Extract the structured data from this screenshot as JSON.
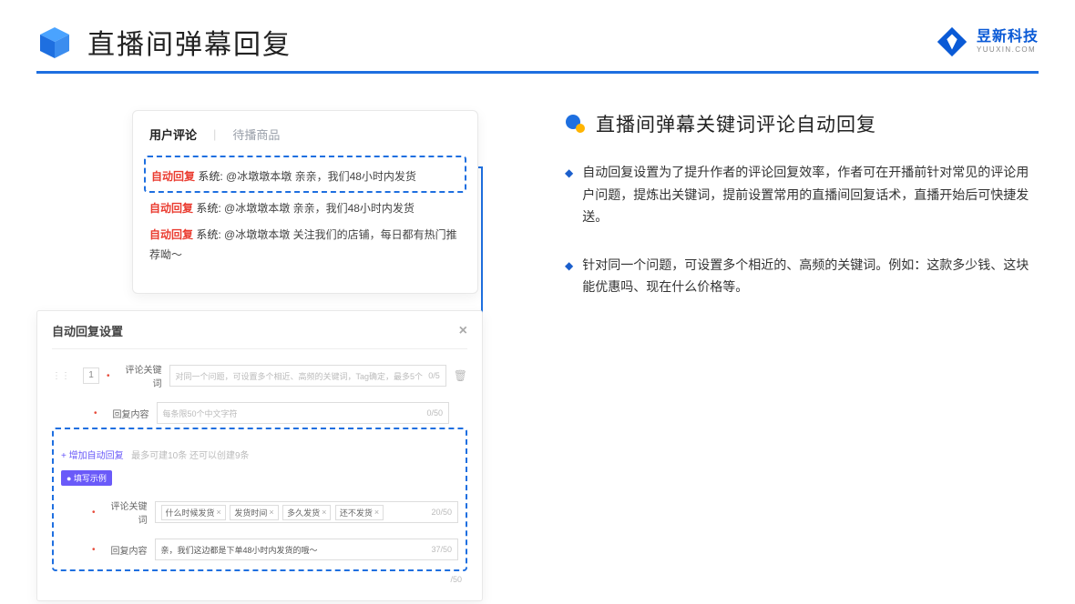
{
  "header": {
    "title": "直播间弹幕回复",
    "brand_cn": "昱新科技",
    "brand_en": "YUUXIN.COM"
  },
  "comments": {
    "tab_active": "用户评论",
    "tab_inactive": "待播商品",
    "ar_label": "自动回复",
    "sys_label": "系统:",
    "row1": "@冰墩墩本墩 亲亲，我们48小时内发货",
    "row2": "@冰墩墩本墩 亲亲，我们48小时内发货",
    "row3": "@冰墩墩本墩 关注我们的店铺，每日都有热门推荐呦～"
  },
  "settings": {
    "title": "自动回复设置",
    "num": "1",
    "label_keyword": "评论关键词",
    "placeholder_keyword": "对同一个问题，可设置多个相近、高频的关键词，Tag确定，最多5个",
    "count_keyword": "0/5",
    "label_content": "回复内容",
    "placeholder_content": "每条限50个中文字符",
    "count_content": "0/50",
    "add_link": "+ 增加自动回复",
    "add_hint": "最多可建10条 还可以创建9条",
    "example_badge": "● 填写示例",
    "ex_label_kw": "评论关键词",
    "ex_tags": [
      "什么时候发货",
      "发货时间",
      "多久发货",
      "还不发货"
    ],
    "ex_kw_count": "20/50",
    "ex_label_ct": "回复内容",
    "ex_content": "亲，我们这边都是下单48小时内发货的哦～",
    "ex_ct_count": "37/50",
    "extra_count": "/50"
  },
  "right": {
    "title": "直播间弹幕关键词评论自动回复",
    "bullet1": "自动回复设置为了提升作者的评论回复效率，作者可在开播前针对常见的评论用户问题，提炼出关键词，提前设置常用的直播间回复话术，直播开始后可快捷发送。",
    "bullet2": "针对同一个问题，可设置多个相近的、高频的关键词。例如：这款多少钱、这块能优惠吗、现在什么价格等。"
  }
}
